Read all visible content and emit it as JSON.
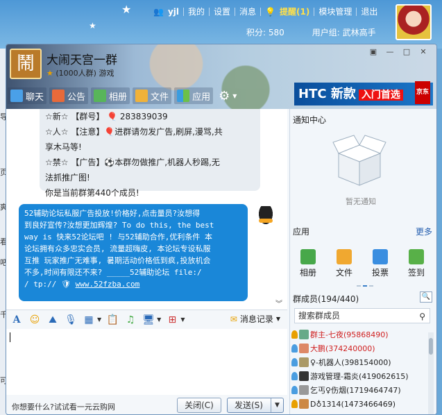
{
  "topbar": {
    "user": "yjl",
    "items": [
      "我的",
      "设置",
      "消息",
      "提醒(1)",
      "模块管理",
      "退出"
    ],
    "points": "积分: 580",
    "group": "用户组: 武林高手"
  },
  "left_strip": [
    "导",
    "页",
    "爽",
    "看",
    "吧",
    "",
    "千",
    "",
    "可"
  ],
  "group": {
    "logo_char": "鬧",
    "title": "大闹天宫一群",
    "subtitle": "(1000人群) 游戏"
  },
  "tabs": [
    "聊天",
    "公告",
    "相册",
    "文件",
    "应用"
  ],
  "ad": {
    "brand": "HTC 新款",
    "tag": "入门首选",
    "shop": "京东"
  },
  "chat": {
    "announcement": [
      "☆新☆ 【群号】 🎈 283839039",
      "☆人☆ 【注意】🎈进群请勿发广告,刷屏,漫骂,共",
      "享木马等!",
      "☆禁☆ 【广告】⚽本群勿做推广,机器人秒踢,无",
      "法抓推广图!",
      "你是当前群第440个成员!"
    ],
    "blue_message": [
      "52辅助论坛私服广告投放!价格好,点击量员?汝想得",
      "到良好宣传?汝想更加辉煌? To do this, the best",
      "way is 快来52论坛吧 ! 与52辅助合作,优利条件 本",
      "论坛拥有众多忠实会员, 流量超嗨皮, 本论坛专设私服",
      "互推 玩家推广无难事, 暑期活动价格低到疯,投放机会",
      "不多,时间有限还不来? _____52辅助论坛    file:/",
      "/ tp:// "
    ],
    "link": "www.52fzba.com",
    "history_label": "消息记录"
  },
  "bottom": {
    "ad": "你想要什么?试试看一元云购网",
    "close": "关闭(C)",
    "send": "发送(S)"
  },
  "right": {
    "notice_title": "通知中心",
    "no_notice": "暂无通知",
    "app_title": "应用",
    "more": "更多",
    "apps": [
      "相册",
      "文件",
      "投票",
      "签到"
    ],
    "members_title": "群成员(194/440)",
    "search_placeholder": "搜索群成员",
    "members": [
      {
        "name": "群主-七夜(95868490)",
        "color": "#d02020"
      },
      {
        "name": "大鹏(374240000)",
        "color": "#d02020"
      },
      {
        "name": "♀-机器人(398154000)",
        "color": "#222222"
      },
      {
        "name": "游戏管理-霜炎(419062615)",
        "color": "#222222"
      },
      {
        "name": "乞丐♀伤烟(1719464747)",
        "color": "#222222"
      },
      {
        "name": "D♁1314(1473466469)",
        "color": "#222222"
      }
    ]
  }
}
